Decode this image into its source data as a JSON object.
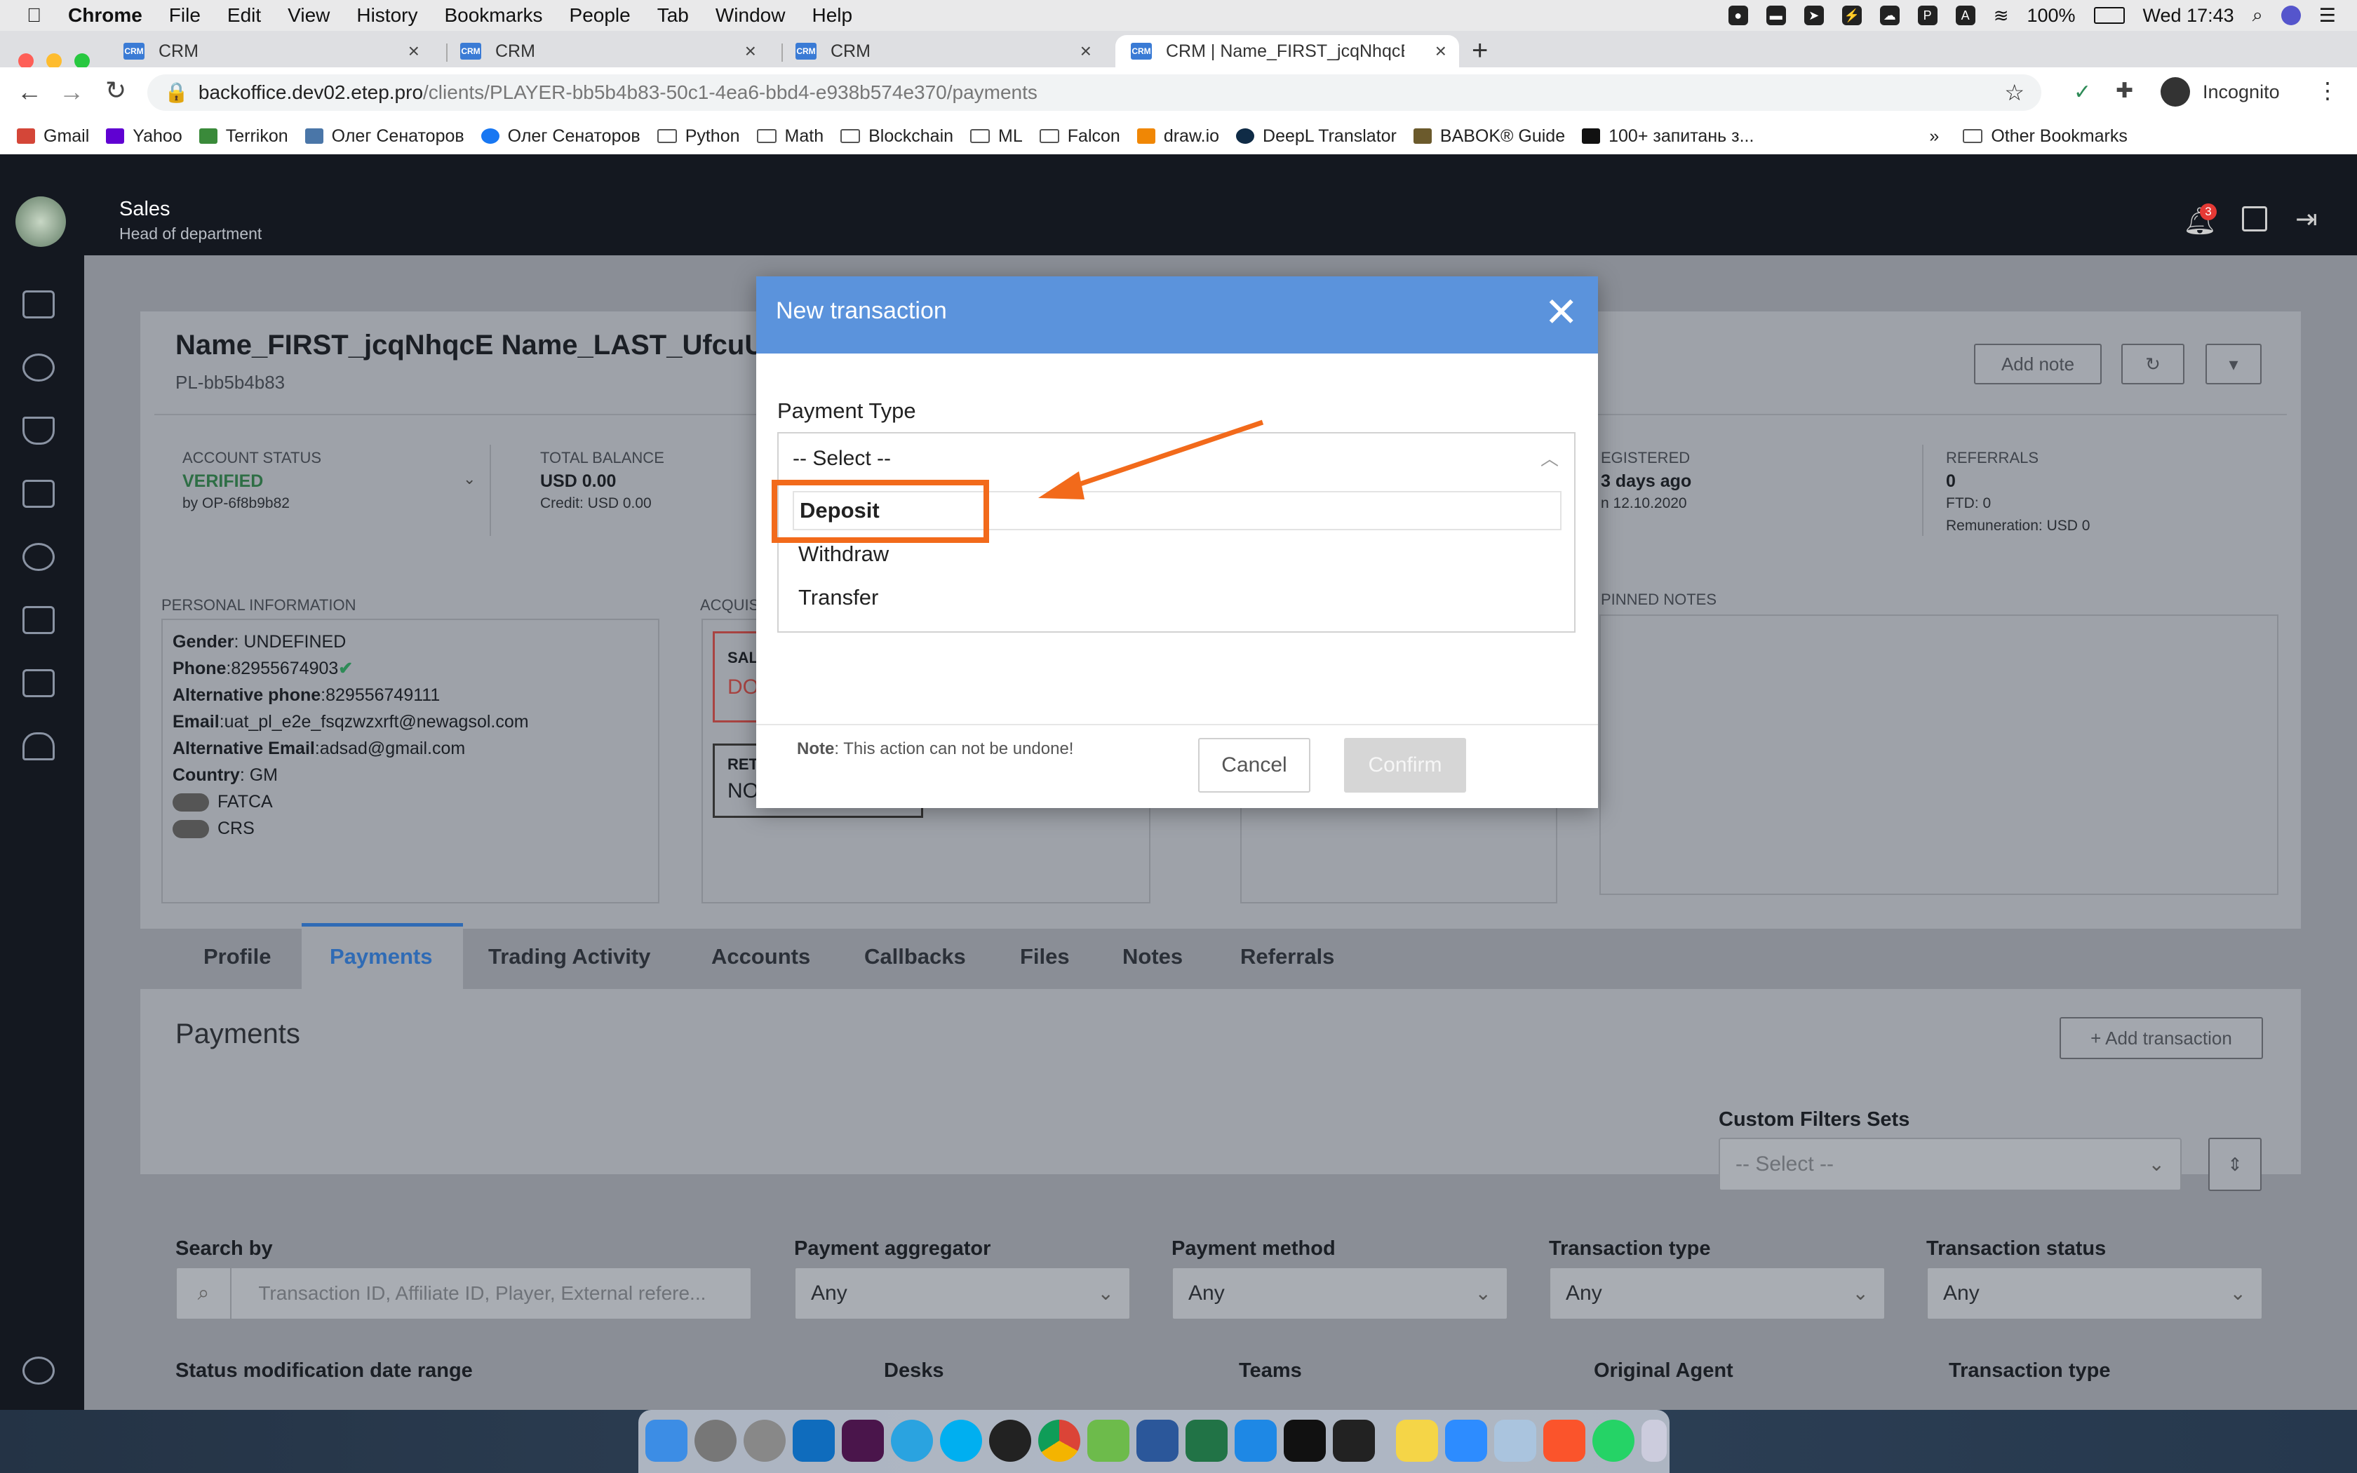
{
  "menubar": {
    "app": "Chrome",
    "menus": [
      "File",
      "Edit",
      "View",
      "History",
      "Bookmarks",
      "People",
      "Tab",
      "Window",
      "Help"
    ],
    "battery": "100%",
    "clock": "Wed 17:43"
  },
  "tabs": [
    {
      "label": "CRM"
    },
    {
      "label": "CRM"
    },
    {
      "label": "CRM"
    },
    {
      "label": "CRM | Name_FIRST_jcqNhqcE"
    }
  ],
  "url": {
    "host": "backoffice.dev02.etep.pro",
    "path": "/clients/PLAYER-bb5b4b83-50c1-4ea6-bbd4-e938b574e370/payments"
  },
  "profile_label": "Incognito",
  "bookmarks": [
    "Gmail",
    "Yahoo",
    "Terrikon",
    "Олег Сенаторов",
    "Олег Сенаторов",
    "Python",
    "Math",
    "Blockchain",
    "ML",
    "Falcon",
    "draw.io",
    "DeepL Translator",
    "BABOK® Guide",
    "100+ запитань з..."
  ],
  "other_bookmarks": "Other Bookmarks",
  "header": {
    "dept": "Sales",
    "role": "Head of department",
    "notif_count": "3"
  },
  "client": {
    "name": "Name_FIRST_jcqNhqcE Name_LAST_UfcuU",
    "id": "PL-bb5b4b83",
    "add_note": "Add note",
    "account_status_label": "ACCOUNT STATUS",
    "account_status": "VERIFIED",
    "account_status_by": "by OP-6f8b9b82",
    "balance_label": "TOTAL BALANCE",
    "balance": "USD 0.00",
    "credit": "Credit: USD 0.00",
    "registered_label": "EGISTERED",
    "registered": "3 days ago",
    "registered_date": "n 12.10.2020",
    "referrals_label": "REFERRALS",
    "referrals": "0",
    "ftd": "FTD: 0",
    "remuneration": "Remuneration: USD 0"
  },
  "personal": {
    "title": "PERSONAL INFORMATION",
    "rows": [
      {
        "k": "Gender",
        "v": ": UNDEFINED"
      },
      {
        "k": "Phone",
        "v": ":82955674903"
      },
      {
        "k": "Alternative phone",
        "v": ":829556749111"
      },
      {
        "k": "Email",
        "v": ":uat_pl_e2e_fsqzwzxrft@newagsol.com"
      },
      {
        "k": "Alternative Email",
        "v": ":adsad@gmail.com"
      },
      {
        "k": "Country",
        "v": ": GM"
      }
    ],
    "toggles": [
      "FATCA",
      "CRS"
    ]
  },
  "acq": {
    "title": "ACQUIS",
    "sal": "SAL",
    "sal_val": "DO",
    "ret": "RET",
    "ret_val": "NO"
  },
  "pinned_title": "PINNED NOTES",
  "profile_tabs": [
    "Profile",
    "Payments",
    "Trading Activity",
    "Accounts",
    "Callbacks",
    "Files",
    "Notes",
    "Referrals"
  ],
  "payments": {
    "title": "Payments",
    "add_tx": "+ Add transaction",
    "custom_filters_label": "Custom Filters Sets",
    "custom_filters_value": "-- Select --",
    "filters": [
      {
        "label": "Search by",
        "value": ""
      },
      {
        "label": "Payment aggregator",
        "value": "Any"
      },
      {
        "label": "Payment method",
        "value": "Any"
      },
      {
        "label": "Transaction type",
        "value": "Any"
      },
      {
        "label": "Transaction status",
        "value": "Any"
      }
    ],
    "search_placeholder": "Transaction ID, Affiliate ID, Player, External refere...",
    "filters2": [
      "Status modification date range",
      "Desks",
      "Teams",
      "Original Agent",
      "Transaction type"
    ]
  },
  "modal": {
    "title": "New transaction",
    "field_label": "Payment Type",
    "selected": "-- Select --",
    "options": [
      "Deposit",
      "Withdraw",
      "Transfer"
    ],
    "note_bold": "Note",
    "note_text": ": This action can not be undone!",
    "cancel": "Cancel",
    "confirm": "Confirm"
  },
  "colors": {
    "modal_header": "#5b93dc",
    "highlight": "#f26a1b",
    "verified": "#2e8b57",
    "active_tab": "#3a7bd5"
  }
}
